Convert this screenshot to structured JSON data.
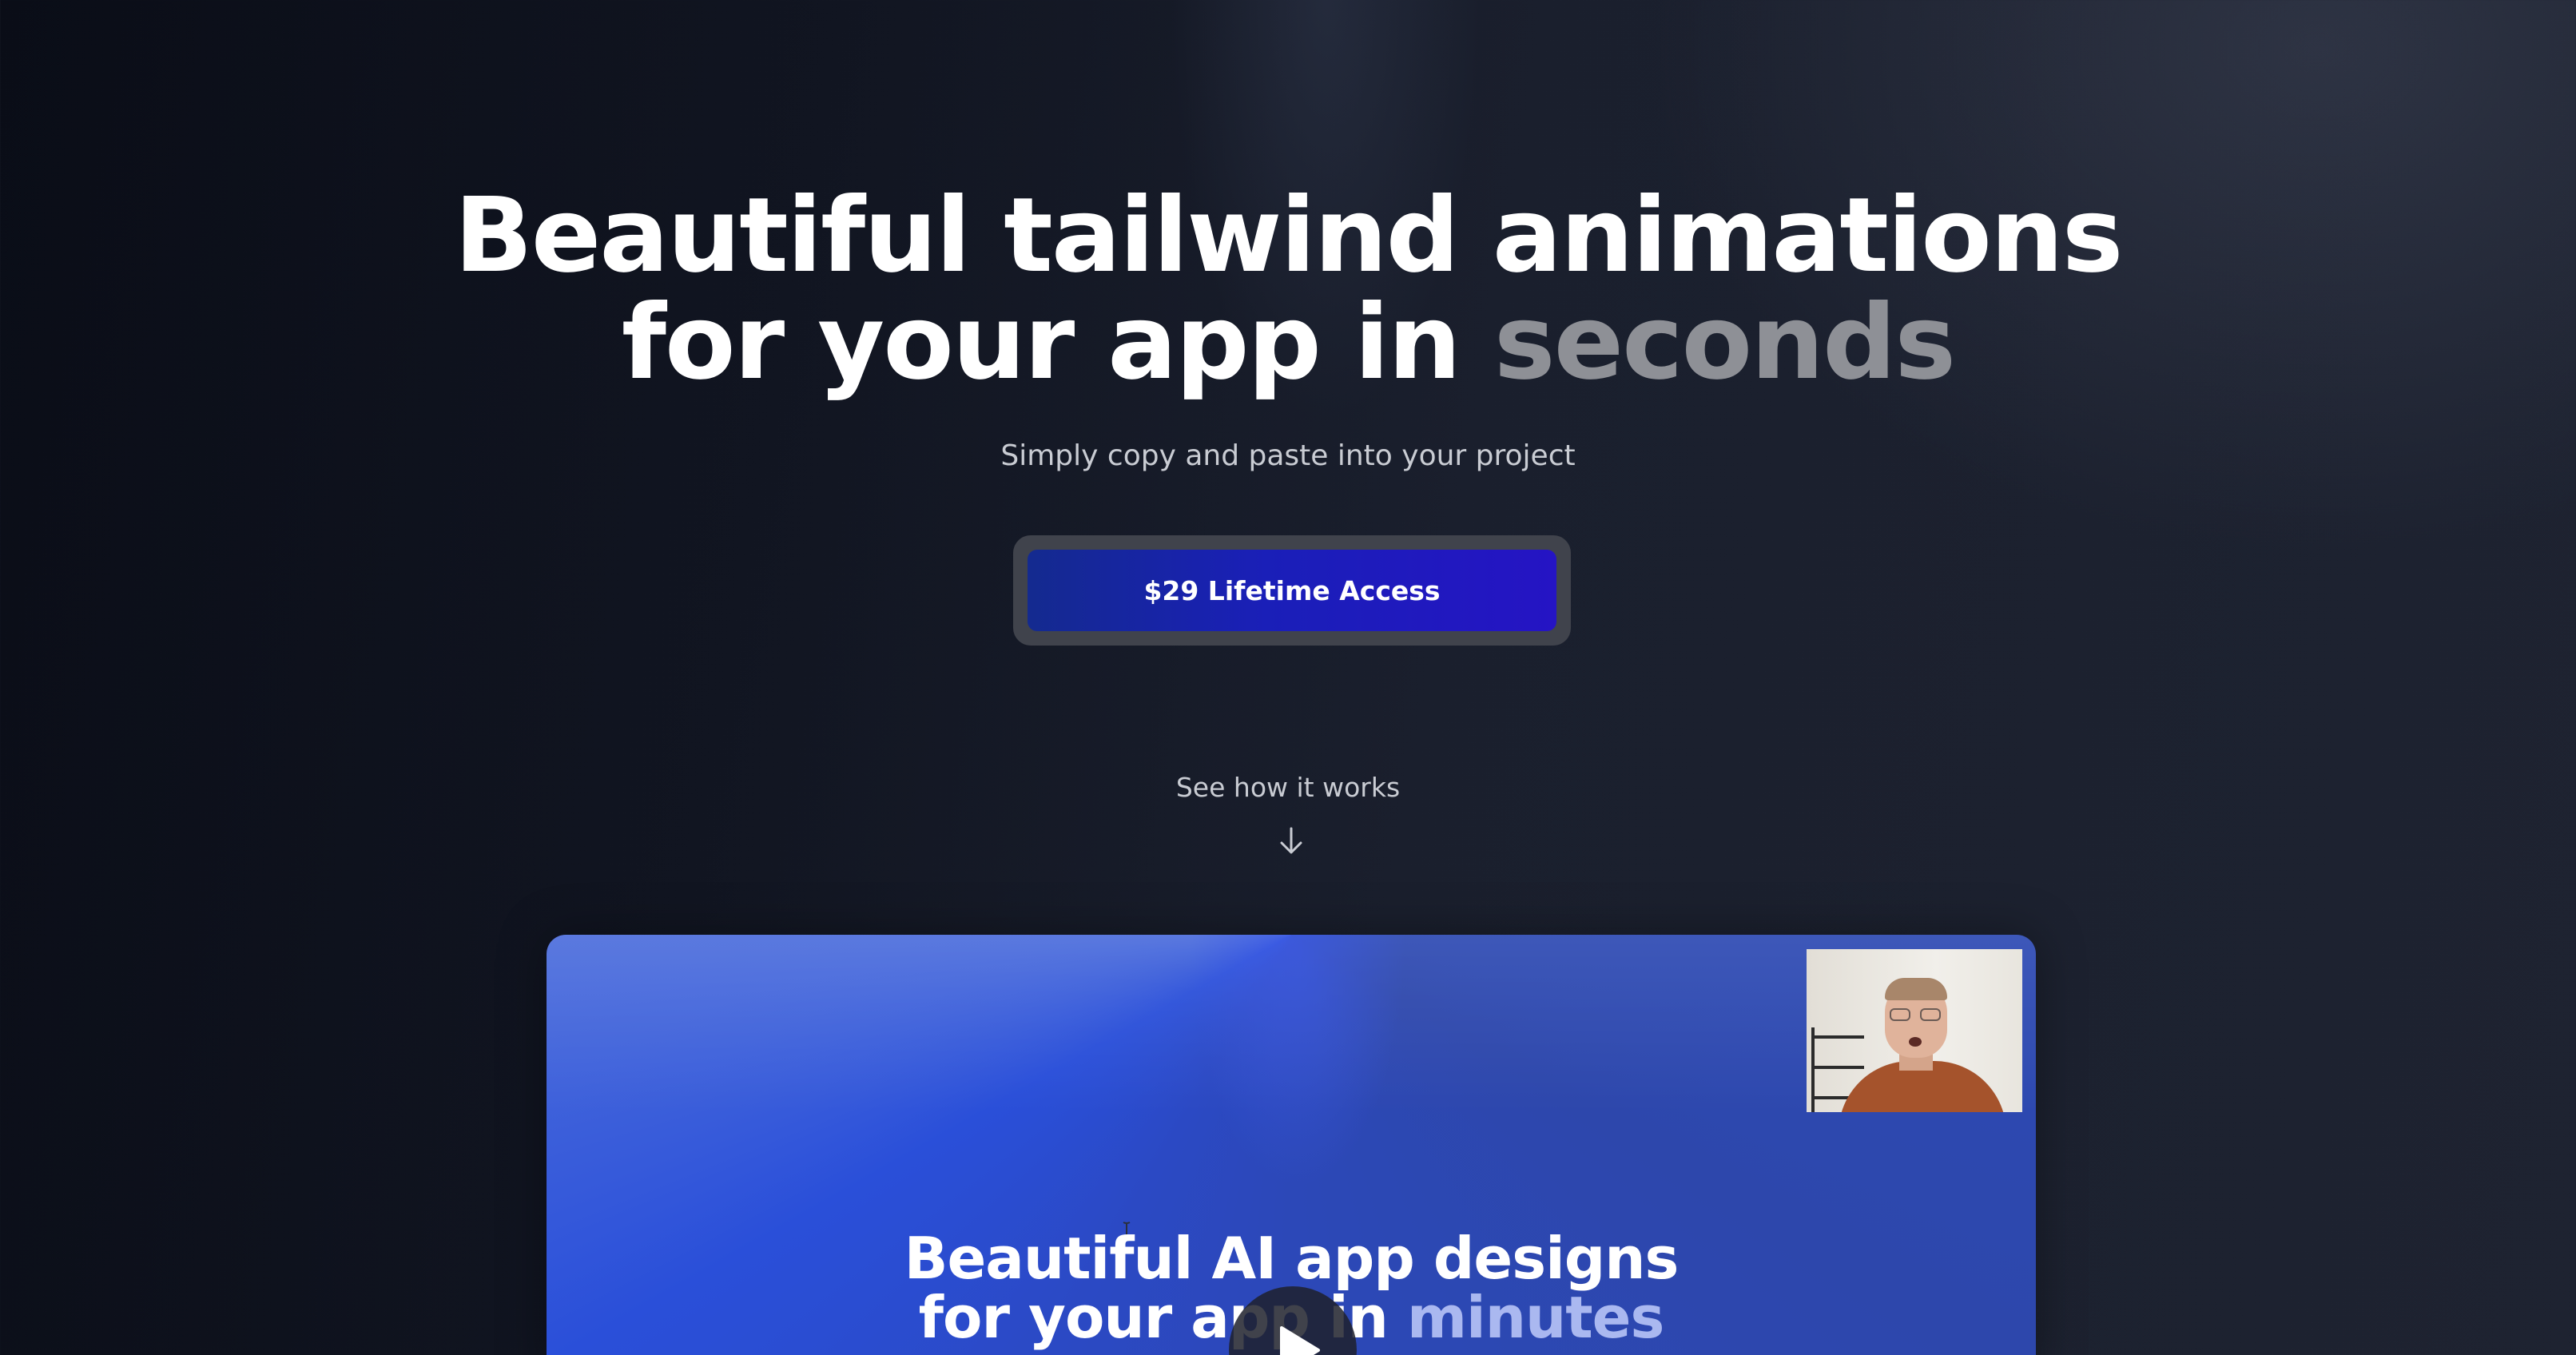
{
  "hero": {
    "title_line1": "Beautiful tailwind animations",
    "title_line2_prefix": "for your app in ",
    "title_line2_accent": "seconds",
    "subtitle": "Simply copy and paste into your project"
  },
  "cta": {
    "label": "$29 Lifetime Access"
  },
  "how_it_works": {
    "label": "See how it works",
    "icon": "arrow-down-icon"
  },
  "video_preview": {
    "title_line1": "Beautiful AI app designs",
    "title_line2_prefix": "for your app in ",
    "title_line2_accent": "minutes",
    "play_icon": "play-icon",
    "webcam": "presenter-webcam-thumbnail"
  },
  "colors": {
    "background": "#141824",
    "accent_gray": "#8e9096",
    "cta_blue": "#1a1fb8",
    "card_blue": "#2d4cba"
  }
}
